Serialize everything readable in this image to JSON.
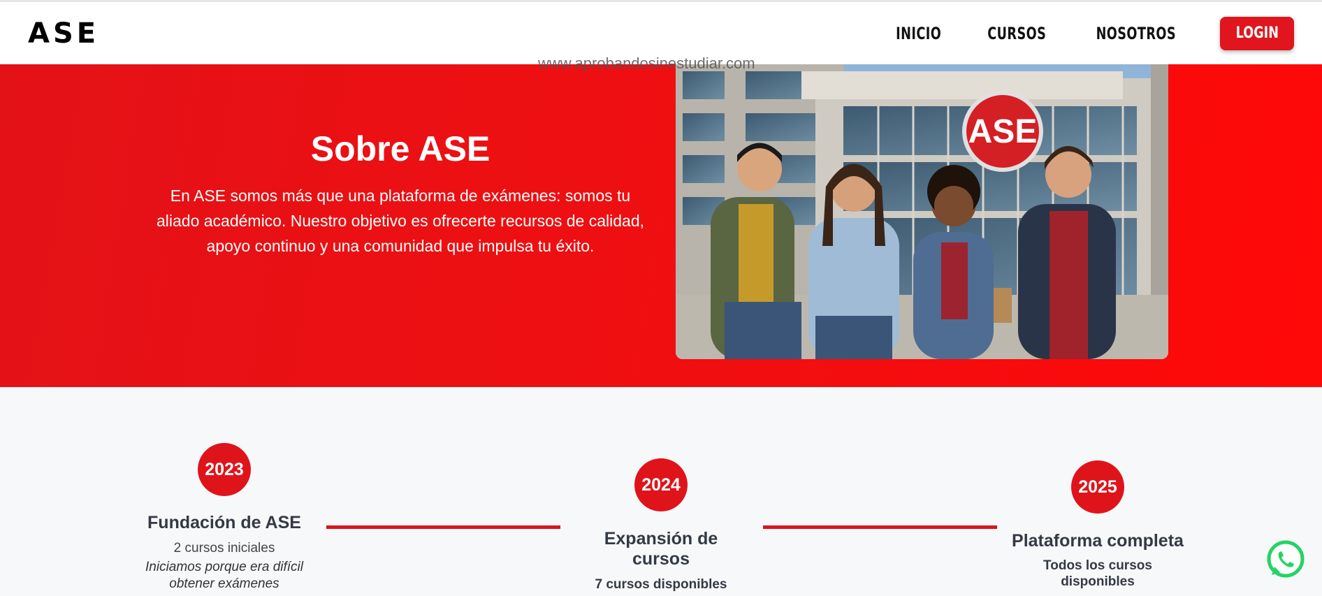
{
  "header": {
    "logo": "ASE",
    "nav": [
      "INICIO",
      "CURSOS",
      "NOSOTROS"
    ],
    "login_label": "LOGIN"
  },
  "hero": {
    "url_text": "www.aprobandosinestudiar.com",
    "title": "Sobre ASE",
    "description": "En ASE somos más que una plataforma de exámenes: somos tu aliado académico. Nuestro objetivo es ofrecerte recursos de calidad, apoyo continuo y una comunidad que impulsa tu éxito.",
    "photo_sign": "ASE"
  },
  "timeline": [
    {
      "year": "2023",
      "title": "Fundación de ASE",
      "subtitle": "2 cursos iniciales",
      "description": "Iniciamos porque era difícil obtener exámenes"
    },
    {
      "year": "2024",
      "title": "Expansión de cursos",
      "subtitle": "7 cursos disponibles"
    },
    {
      "year": "2025",
      "title": "Plataforma completa",
      "subtitle": "Todos los cursos disponibles"
    }
  ],
  "colors": {
    "brand_red": "#e0151d",
    "section_bg": "#f7f8fa",
    "whatsapp_green": "#25d366"
  },
  "icons": {
    "chat": "whatsapp-icon"
  }
}
